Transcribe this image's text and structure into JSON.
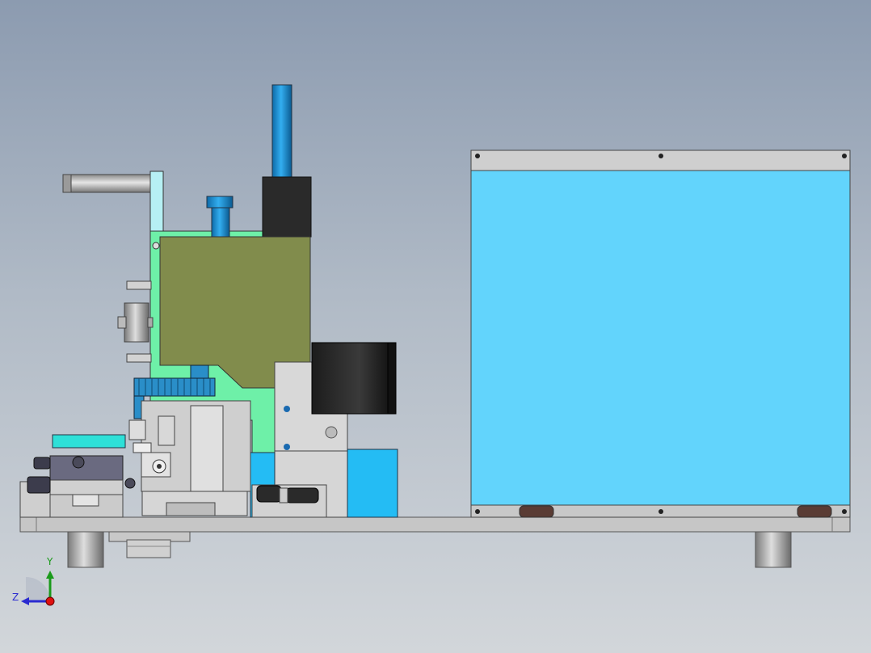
{
  "view": {
    "background_top": "#8c9bb0",
    "background_bottom": "#d2d6da"
  },
  "triad": {
    "y_label": "Y",
    "z_label": "Z",
    "y_color": "#1a9a1a",
    "z_color": "#2a2ad0",
    "x_color": "#e01010"
  },
  "colors": {
    "cabinet_panel": "#62d4fc",
    "frame_metal": "#c8c8c8",
    "olive_block": "#818c4c",
    "green_plate": "#6ef0a8",
    "cylinder_blue": "#1a8ad0",
    "motor_dark": "#2a2a2a",
    "slide_purple": "#6a6a80",
    "blue_block": "#24bcf4"
  }
}
